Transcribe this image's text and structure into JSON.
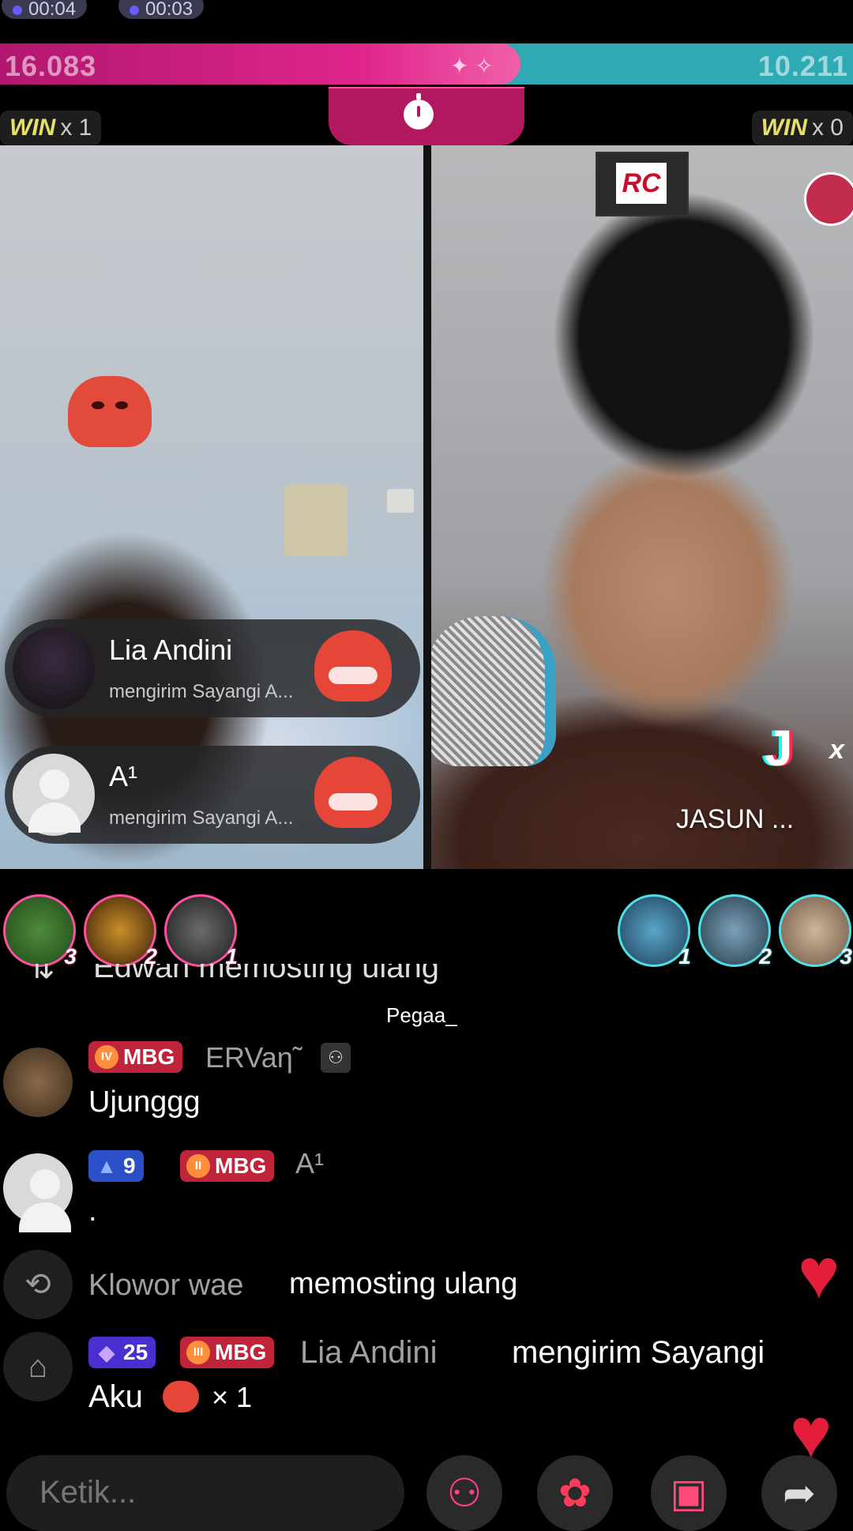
{
  "timers": {
    "left": "00:04",
    "right": "00:03"
  },
  "battle": {
    "left_score": "16.083",
    "right_score": "10.211",
    "left_share": 0.61
  },
  "wins": {
    "left": {
      "label": "WIN",
      "count": "x 1"
    },
    "right": {
      "label": "WIN",
      "count": "x 0"
    }
  },
  "right_stream": {
    "logo": "RC",
    "name": "JASUN ...",
    "badge_x": "x"
  },
  "gift_notifications": [
    {
      "name": "Lia Andini",
      "text": "mengirim Sayangi A..."
    },
    {
      "name": "A¹",
      "text": "mengirim Sayangi A..."
    }
  ],
  "contributors_left": [
    {
      "rank": "3"
    },
    {
      "rank": "2"
    },
    {
      "rank": "1"
    }
  ],
  "contributors_right": [
    {
      "rank": "1"
    },
    {
      "rank": "2"
    },
    {
      "rank": "3"
    }
  ],
  "chat": {
    "cut_line": "Edwan memosting ulang",
    "typing_user": "Pegaa_",
    "messages": [
      {
        "badge": "MBG",
        "level_icon": "IV",
        "user": "ERVaη̃",
        "text": "Ujunggg"
      },
      {
        "level": "9",
        "badge": "MBG",
        "level_icon": "II",
        "user": "A¹",
        "text": "."
      },
      {
        "user": "Klowor wae",
        "text": "memosting ulang"
      },
      {
        "gems": "25",
        "badge": "MBG",
        "level_icon": "III",
        "user": "Lia Andini",
        "text": "mengirim Sayangi",
        "text2": "Aku",
        "count": "× 1"
      }
    ]
  },
  "composer": {
    "placeholder": "Ketik..."
  },
  "colors": {
    "pink": "#e0258d",
    "teal": "#2fa9b4",
    "heart": "#e41d3b"
  }
}
